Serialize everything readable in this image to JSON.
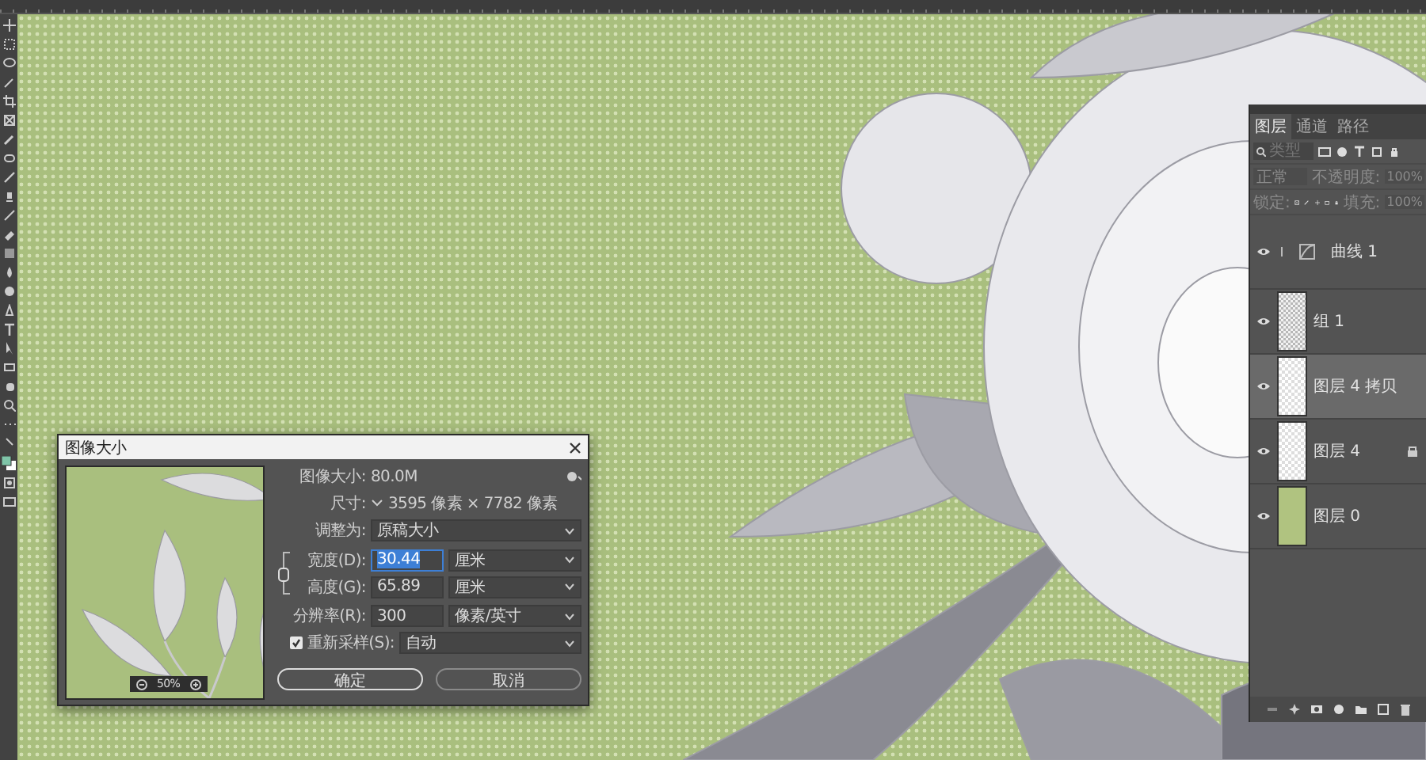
{
  "dialog": {
    "title": "图像大小",
    "image_size_label": "图像大小:",
    "image_size": "80.0M",
    "dimensions_label": "尺寸:",
    "dimensions": "3595 像素 × 7782 像素",
    "fit_to_label": "调整为:",
    "fit_to": "原稿大小",
    "fields": [
      {
        "label": "宽度(D):",
        "value": "30.44",
        "selected": true,
        "unit": "厘米"
      },
      {
        "label": "高度(G):",
        "value": "65.89",
        "selected": false,
        "unit": "厘米"
      },
      {
        "label": "分辨率(R):",
        "value": "300",
        "selected": false,
        "unit": "像素/英寸"
      }
    ],
    "resample": {
      "label": "重新采样(S):",
      "checked": true,
      "value": "自动"
    },
    "preview_zoom": "50%",
    "buttons": [
      {
        "label": "确定",
        "kind": "primary"
      },
      {
        "label": "取消",
        "kind": "secondary"
      }
    ]
  },
  "layers_panel": {
    "tabs": [
      {
        "label": "图层",
        "selected": true
      },
      {
        "label": "通道",
        "selected": false
      },
      {
        "label": "路径",
        "selected": false
      }
    ],
    "filter_placeholder": "类型",
    "blend_mode": "正常",
    "opacity_label": "不透明度:",
    "opacity": "100%",
    "lock_label": "锁定:",
    "fill_label": "填充:",
    "fill": "100%",
    "layers": [
      {
        "name": "曲线 1",
        "kind": "adjustment",
        "visible": true,
        "selected": false,
        "locked": false
      },
      {
        "name": "组 1",
        "kind": "pattern",
        "visible": true,
        "selected": false,
        "locked": false
      },
      {
        "name": "图层 4 拷贝",
        "kind": "transparent",
        "visible": true,
        "selected": true,
        "locked": false
      },
      {
        "name": "图层 4",
        "kind": "transparent",
        "visible": true,
        "selected": false,
        "locked": true
      },
      {
        "name": "图层 0",
        "kind": "solid",
        "visible": true,
        "selected": false,
        "locked": false
      }
    ]
  }
}
